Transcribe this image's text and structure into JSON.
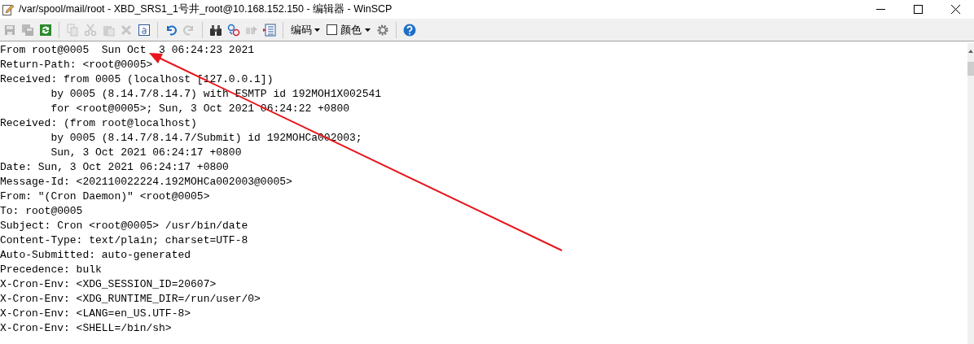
{
  "window": {
    "title": "/var/spool/mail/root - XBD_SRS1_1号井_root@10.168.152.150 - 编辑器 - WinSCP"
  },
  "toolbar": [
    {
      "kind": "icon",
      "disabled": true
    },
    {
      "kind": "icon",
      "disabled": true
    },
    {
      "kind": "icon",
      "disabled": false
    },
    {
      "kind": "separator"
    },
    {
      "kind": "icon",
      "disabled": true
    },
    {
      "kind": "icon",
      "disabled": true
    },
    {
      "kind": "icon",
      "disabled": true
    },
    {
      "kind": "icon",
      "disabled": true
    },
    {
      "kind": "icon",
      "disabled": false
    },
    {
      "kind": "separator"
    },
    {
      "kind": "icon",
      "disabled": false
    },
    {
      "kind": "icon",
      "disabled": true
    },
    {
      "kind": "separator"
    },
    {
      "kind": "icon",
      "disabled": false
    },
    {
      "kind": "icon",
      "disabled": false
    },
    {
      "kind": "icon",
      "disabled": true
    },
    {
      "kind": "icon",
      "disabled": false
    },
    {
      "kind": "separator"
    },
    {
      "kind": "dropdown",
      "label": "编码"
    },
    {
      "kind": "checkbox",
      "label": "颜色",
      "checked": false
    },
    {
      "kind": "icon",
      "disabled": false
    },
    {
      "kind": "separator"
    },
    {
      "kind": "icon",
      "disabled": false
    }
  ],
  "editor": {
    "lines": [
      "From root@0005  Sun Oct  3 06:24:23 2021",
      "Return-Path: <root@0005>",
      "Received: from 0005 (localhost [127.0.0.1])",
      "        by 0005 (8.14.7/8.14.7) with ESMTP id 192MOH1X002541",
      "        for <root@0005>; Sun, 3 Oct 2021 06:24:22 +0800",
      "Received: (from root@localhost)",
      "        by 0005 (8.14.7/8.14.7/Submit) id 192MOHCa002003;",
      "        Sun, 3 Oct 2021 06:24:17 +0800",
      "Date: Sun, 3 Oct 2021 06:24:17 +0800",
      "Message-Id: <202110022224.192MOHCa002003@0005>",
      "From: \"(Cron Daemon)\" <root@0005>",
      "To: root@0005",
      "Subject: Cron <root@0005> /usr/bin/date",
      "Content-Type: text/plain; charset=UTF-8",
      "Auto-Submitted: auto-generated",
      "Precedence: bulk",
      "X-Cron-Env: <XDG_SESSION_ID=20607>",
      "X-Cron-Env: <XDG_RUNTIME_DIR=/run/user/0>",
      "X-Cron-Env: <LANG=en_US.UTF-8>",
      "X-Cron-Env: <SHELL=/bin/sh>"
    ]
  }
}
